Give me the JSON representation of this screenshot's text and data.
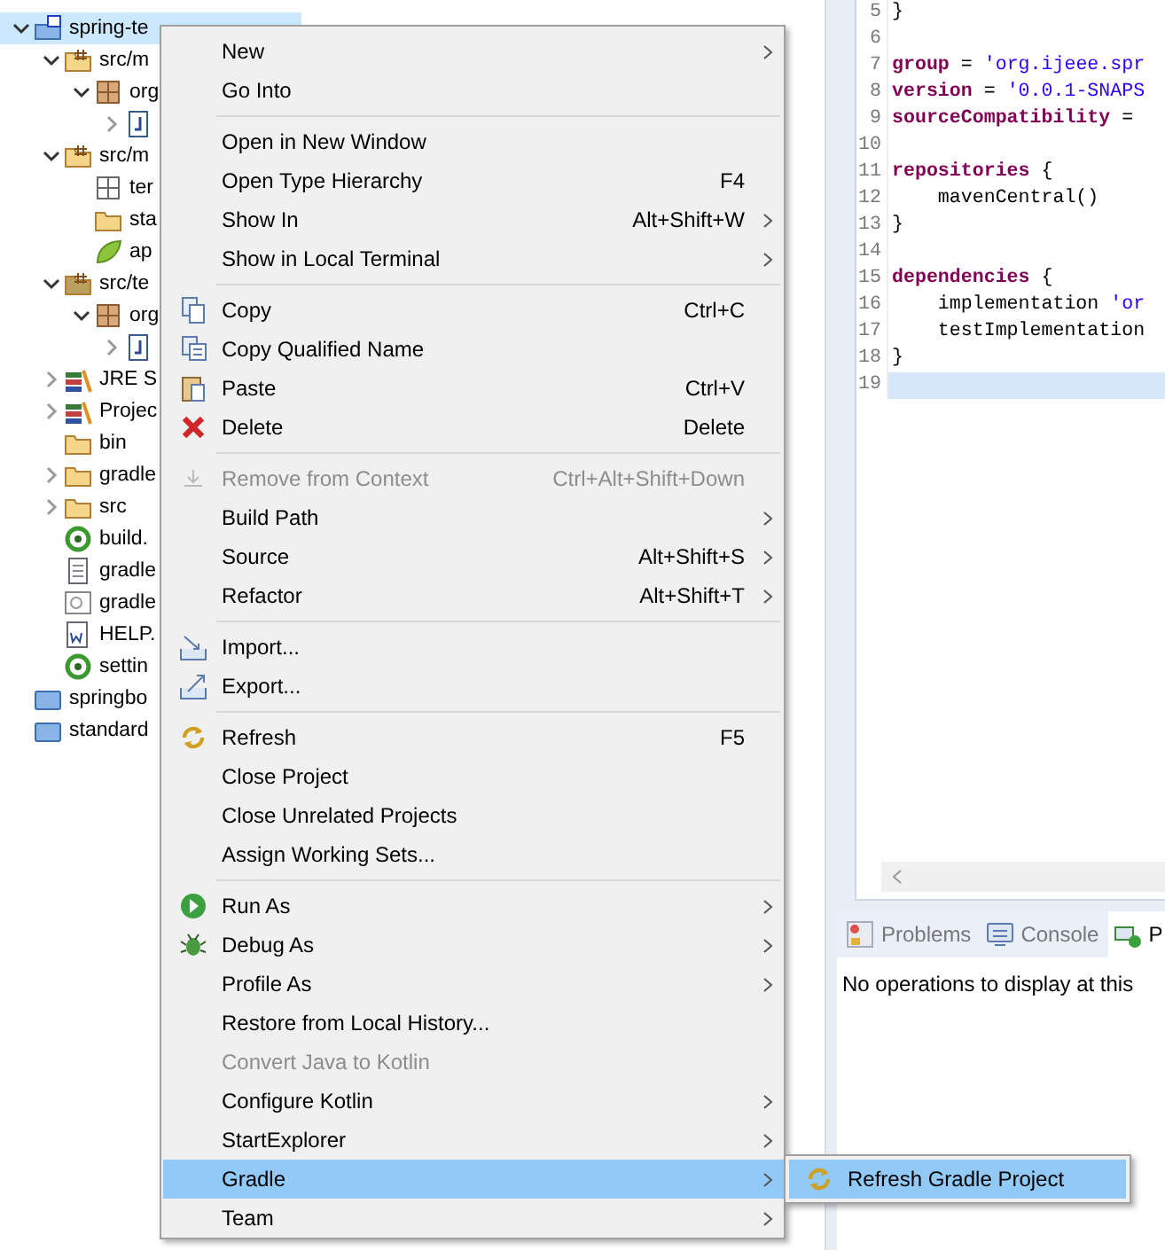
{
  "tree": [
    {
      "label": "spring-te",
      "kind": "gradle-project",
      "expanded": true,
      "selected": true,
      "children": [
        {
          "label": "src/m",
          "kind": "source-folder",
          "expanded": true,
          "children": [
            {
              "label": "org",
              "kind": "package",
              "expanded": true,
              "children": [
                {
                  "kind": "java-file",
                  "expanded": false
                }
              ]
            }
          ]
        },
        {
          "label": "src/m",
          "kind": "source-folder",
          "expanded": true,
          "children": [
            {
              "label": "ter",
              "kind": "empty-package"
            },
            {
              "label": "sta",
              "kind": "folder"
            },
            {
              "label": "ap",
              "kind": "leaf"
            }
          ]
        },
        {
          "label": "src/te",
          "kind": "test-folder",
          "expanded": true,
          "children": [
            {
              "label": "org",
              "kind": "package",
              "expanded": true,
              "children": [
                {
                  "kind": "java-file",
                  "expanded": false
                }
              ]
            }
          ]
        },
        {
          "label": "JRE S",
          "kind": "library",
          "expanded": false
        },
        {
          "label": "Projec",
          "kind": "library",
          "expanded": false
        },
        {
          "label": "bin",
          "kind": "folder"
        },
        {
          "label": "gradle",
          "kind": "folder",
          "expanded": false
        },
        {
          "label": "src",
          "kind": "folder",
          "expanded": false
        },
        {
          "label": "build.",
          "kind": "gradle-file"
        },
        {
          "label": "gradle",
          "kind": "text-file"
        },
        {
          "label": "gradle",
          "kind": "config-file"
        },
        {
          "label": "HELP.",
          "kind": "doc-file"
        },
        {
          "label": "settin",
          "kind": "gradle-file"
        }
      ]
    },
    {
      "label": "springbo",
      "kind": "project-folder"
    },
    {
      "label": "standard",
      "kind": "project-folder"
    }
  ],
  "editor": {
    "lines": [
      {
        "number": "5",
        "current": false,
        "tokens": [
          {
            "text": "}",
            "kind": "plain"
          }
        ]
      },
      {
        "number": "6",
        "current": false
      },
      {
        "number": "7",
        "current": false,
        "tokens": [
          {
            "text": "group",
            "kind": "keyword"
          },
          {
            "text": " = ",
            "kind": "plain"
          },
          {
            "text": "'org.ijeee.spr",
            "kind": "string"
          }
        ]
      },
      {
        "number": "8",
        "current": false,
        "tokens": [
          {
            "text": "version",
            "kind": "keyword"
          },
          {
            "text": " = ",
            "kind": "plain"
          },
          {
            "text": "'0.0.1-SNAPS",
            "kind": "string"
          }
        ]
      },
      {
        "number": "9",
        "current": false,
        "tokens": [
          {
            "text": "sourceCompatibility",
            "kind": "keyword"
          },
          {
            "text": " =",
            "kind": "plain"
          }
        ]
      },
      {
        "number": "10",
        "current": false
      },
      {
        "number": "11",
        "current": false,
        "tokens": [
          {
            "text": "repositories",
            "kind": "keyword"
          },
          {
            "text": " {",
            "kind": "plain"
          }
        ]
      },
      {
        "number": "12",
        "current": false,
        "tokens": [
          {
            "text": "    mavenCentral()",
            "kind": "plain"
          }
        ]
      },
      {
        "number": "13",
        "current": false,
        "tokens": [
          {
            "text": "}",
            "kind": "plain"
          }
        ]
      },
      {
        "number": "14",
        "current": false
      },
      {
        "number": "15",
        "current": false,
        "tokens": [
          {
            "text": "dependencies",
            "kind": "keyword"
          },
          {
            "text": " {",
            "kind": "plain"
          }
        ]
      },
      {
        "number": "16",
        "current": false,
        "tokens": [
          {
            "text": "    implementation ",
            "kind": "plain"
          },
          {
            "text": "'or",
            "kind": "string"
          }
        ]
      },
      {
        "number": "17",
        "current": false,
        "tokens": [
          {
            "text": "    testImplementation",
            "kind": "plain"
          }
        ]
      },
      {
        "number": "18",
        "current": false,
        "tokens": [
          {
            "text": "}",
            "kind": "plain"
          }
        ]
      },
      {
        "number": "19",
        "current": true
      }
    ]
  },
  "bottom_panel": {
    "tabs": [
      {
        "label": "Problems",
        "kind": "problems",
        "selected": false
      },
      {
        "label": "Console",
        "kind": "console",
        "selected": false
      },
      {
        "label": "P",
        "kind": "progress",
        "selected": true
      }
    ],
    "message": "No operations to display at this"
  },
  "context_menu": [
    {
      "kind": "plain",
      "label": "New",
      "submenu": true
    },
    {
      "kind": "plain",
      "label": "Go Into"
    },
    {
      "kind": "separator"
    },
    {
      "kind": "plain",
      "label": "Open in New Window"
    },
    {
      "kind": "plain",
      "label": "Open Type Hierarchy",
      "shortcut": "F4"
    },
    {
      "kind": "plain",
      "label": "Show In",
      "shortcut": "Alt+Shift+W",
      "submenu": true
    },
    {
      "kind": "plain",
      "label": "Show in Local Terminal",
      "submenu": true
    },
    {
      "kind": "separator"
    },
    {
      "kind": "copy",
      "label": "Copy",
      "shortcut": "Ctrl+C"
    },
    {
      "kind": "copy-name",
      "label": "Copy Qualified Name"
    },
    {
      "kind": "paste",
      "label": "Paste",
      "shortcut": "Ctrl+V"
    },
    {
      "kind": "delete",
      "label": "Delete",
      "shortcut": "Delete"
    },
    {
      "kind": "separator"
    },
    {
      "kind": "remove",
      "label": "Remove from Context",
      "shortcut": "Ctrl+Alt+Shift+Down",
      "disabled": true
    },
    {
      "kind": "plain",
      "label": "Build Path",
      "submenu": true
    },
    {
      "kind": "plain",
      "label": "Source",
      "shortcut": "Alt+Shift+S",
      "submenu": true
    },
    {
      "kind": "plain",
      "label": "Refactor",
      "shortcut": "Alt+Shift+T",
      "submenu": true
    },
    {
      "kind": "separator"
    },
    {
      "kind": "import",
      "label": "Import..."
    },
    {
      "kind": "export",
      "label": "Export..."
    },
    {
      "kind": "separator"
    },
    {
      "kind": "refresh",
      "label": "Refresh",
      "shortcut": "F5"
    },
    {
      "kind": "plain",
      "label": "Close Project"
    },
    {
      "kind": "plain",
      "label": "Close Unrelated Projects"
    },
    {
      "kind": "plain",
      "label": "Assign Working Sets..."
    },
    {
      "kind": "separator"
    },
    {
      "kind": "run",
      "label": "Run As",
      "submenu": true
    },
    {
      "kind": "debug",
      "label": "Debug As",
      "submenu": true
    },
    {
      "kind": "plain",
      "label": "Profile As",
      "submenu": true
    },
    {
      "kind": "plain",
      "label": "Restore from Local History..."
    },
    {
      "kind": "plain",
      "label": "Convert Java to Kotlin",
      "disabled": true
    },
    {
      "kind": "plain",
      "label": "Configure Kotlin",
      "submenu": true
    },
    {
      "kind": "plain",
      "label": "StartExplorer",
      "submenu": true
    },
    {
      "kind": "plain",
      "label": "Gradle",
      "submenu": true,
      "selected": true
    },
    {
      "kind": "plain",
      "label": "Team",
      "submenu": true
    }
  ],
  "submenu": [
    {
      "kind": "refresh",
      "label": "Refresh Gradle Project",
      "selected": true
    }
  ]
}
